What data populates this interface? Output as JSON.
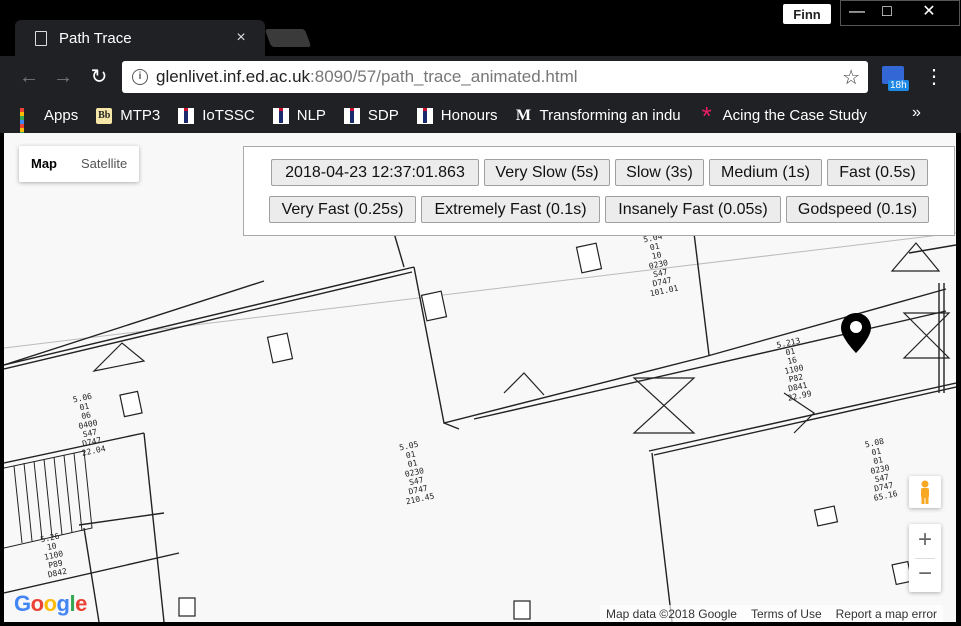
{
  "browser": {
    "tab_title": "Path Trace",
    "tab_close": "×",
    "profile_name": "Finn",
    "window_controls": {
      "minimize": "—",
      "maximize": "□",
      "close": "✕"
    },
    "url_host": "glenlivet.inf.ed.ac.uk",
    "url_path": ":8090/57/path_trace_animated.html",
    "extension_badge": "18h",
    "bookmarks": [
      {
        "label": "Apps",
        "icon": "apps-grid-icon"
      },
      {
        "label": "MTP3",
        "icon": "blackboard-icon"
      },
      {
        "label": "IoTSSC",
        "icon": "uoe-icon"
      },
      {
        "label": "NLP",
        "icon": "uoe-icon"
      },
      {
        "label": "SDP",
        "icon": "uoe-icon"
      },
      {
        "label": "Honours",
        "icon": "uoe-icon"
      },
      {
        "label": "Transforming an indu",
        "icon": "medium-icon"
      },
      {
        "label": "Acing the Case Study",
        "icon": "asterisk-icon"
      }
    ],
    "bookmarks_overflow": "»"
  },
  "map": {
    "map_type": {
      "map": "Map",
      "satellite": "Satellite"
    },
    "speed_buttons_row1": [
      "2018-04-23 12:37:01.863",
      "Very Slow (5s)",
      "Slow (3s)",
      "Medium (1s)",
      "Fast (0.5s)"
    ],
    "speed_buttons_row2": [
      "Very Fast (0.25s)",
      "Extremely Fast (0.1s)",
      "Insanely Fast (0.05s)",
      "Godspeed (0.1s)"
    ],
    "zoom_in": "+",
    "zoom_out": "−",
    "google_letters": [
      "G",
      "o",
      "o",
      "g",
      "l",
      "e"
    ],
    "google_colors": [
      "#4285F4",
      "#EA4335",
      "#FBBC05",
      "#4285F4",
      "#34A853",
      "#EA4335"
    ],
    "attribution": {
      "data": "Map data ©2018 Google",
      "terms": "Terms of Use",
      "report": "Report a map error"
    },
    "room_labels": [
      {
        "id": "room-504",
        "lines": [
          "5.04",
          "01",
          "10",
          "0230",
          "S47",
          "D747",
          "101.01"
        ]
      },
      {
        "id": "room-5213",
        "lines": [
          "5.213",
          "01",
          "16",
          "1100",
          "P82",
          "D841",
          "22.99"
        ]
      },
      {
        "id": "room-506",
        "lines": [
          "5.06",
          "01",
          "06",
          "0400",
          "S47",
          "D747",
          "22.04"
        ]
      },
      {
        "id": "room-505",
        "lines": [
          "5.05",
          "01",
          "01",
          "0230",
          "S47",
          "D747",
          "210.45"
        ]
      },
      {
        "id": "room-508",
        "lines": [
          "5.08",
          "01",
          "01",
          "0230",
          "S47",
          "D747",
          "65.16"
        ]
      },
      {
        "id": "room-526",
        "lines": [
          "5.26",
          "10",
          "1100",
          "P89",
          "D842"
        ]
      }
    ]
  }
}
